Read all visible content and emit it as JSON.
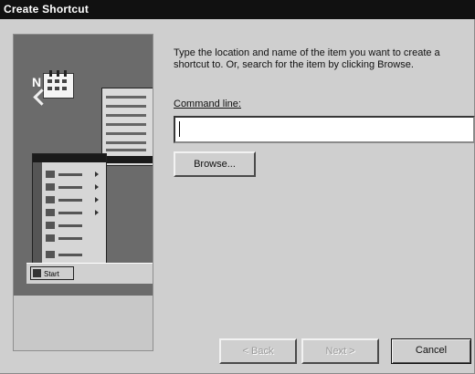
{
  "window": {
    "title": "Create Shortcut"
  },
  "illustration": {
    "startbutton_label": "Start"
  },
  "instructions": "Type the location and name of the item you want to create a shortcut to. Or, search for the item by clicking Browse.",
  "command": {
    "label": "Command line:",
    "value": "",
    "placeholder": ""
  },
  "buttons": {
    "browse": "Browse...",
    "back": "< Back",
    "next": "Next >",
    "cancel": "Cancel"
  }
}
